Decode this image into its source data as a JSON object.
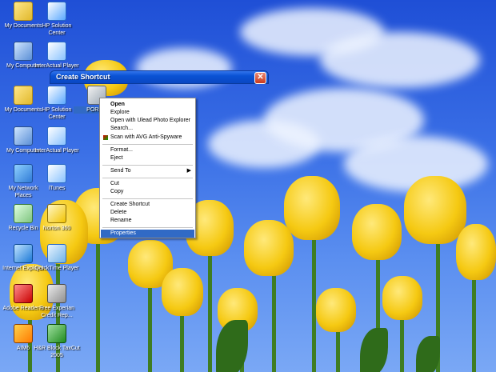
{
  "dialog": {
    "title": "Create Shortcut"
  },
  "desktop_icons": [
    {
      "label": "My Documents",
      "icon": "folder-documents-icon"
    },
    {
      "label": "HP Solution Center",
      "icon": "hp-solution-center-icon"
    },
    {
      "label": "My Computer",
      "icon": "my-computer-icon"
    },
    {
      "label": "InterActual Player",
      "icon": "interactual-player-icon"
    },
    {
      "label": "My Documents",
      "icon": "folder-documents-icon"
    },
    {
      "label": "HP Solution Center",
      "icon": "hp-solution-center-icon"
    },
    {
      "label": "PORNO",
      "icon": "removable-drive-icon"
    },
    {
      "label": "My Computer",
      "icon": "my-computer-icon"
    },
    {
      "label": "InterActual Player",
      "icon": "interactual-player-icon"
    },
    {
      "label": "My Network Places",
      "icon": "network-places-icon"
    },
    {
      "label": "iTunes",
      "icon": "itunes-icon"
    },
    {
      "label": "Recycle Bin",
      "icon": "recycle-bin-icon"
    },
    {
      "label": "Norton 360",
      "icon": "norton-icon"
    },
    {
      "label": "Internet Explorer",
      "icon": "internet-explorer-icon"
    },
    {
      "label": "QuickTime Player",
      "icon": "quicktime-icon"
    },
    {
      "label": "Adobe Reader 9",
      "icon": "adobe-reader-icon"
    },
    {
      "label": "Free Experian Credit Rep...",
      "icon": "experian-icon"
    },
    {
      "label": "AIM6",
      "icon": "aim-icon"
    },
    {
      "label": "H&R Block TaxCut 2005",
      "icon": "hr-block-icon"
    }
  ],
  "context_menu": {
    "items": [
      {
        "label": "Open",
        "bold": true
      },
      {
        "label": "Explore"
      },
      {
        "label": "Open with Ulead Photo Explorer"
      },
      {
        "label": "Search..."
      },
      {
        "label": "Scan with AVG Anti-Spyware",
        "icon": "avg-icon"
      },
      {
        "label": "Format..."
      },
      {
        "label": "Eject"
      },
      {
        "label": "Send To",
        "submenu": true
      },
      {
        "label": "Cut"
      },
      {
        "label": "Copy"
      },
      {
        "label": "Create Shortcut"
      },
      {
        "label": "Delete"
      },
      {
        "label": "Rename"
      },
      {
        "label": "Properties",
        "selected": true
      }
    ]
  },
  "colors": {
    "selection": "#316ac5",
    "titlebar": "#0a52d4",
    "sky": "#2f66e0",
    "tulip": "#f5c912"
  }
}
